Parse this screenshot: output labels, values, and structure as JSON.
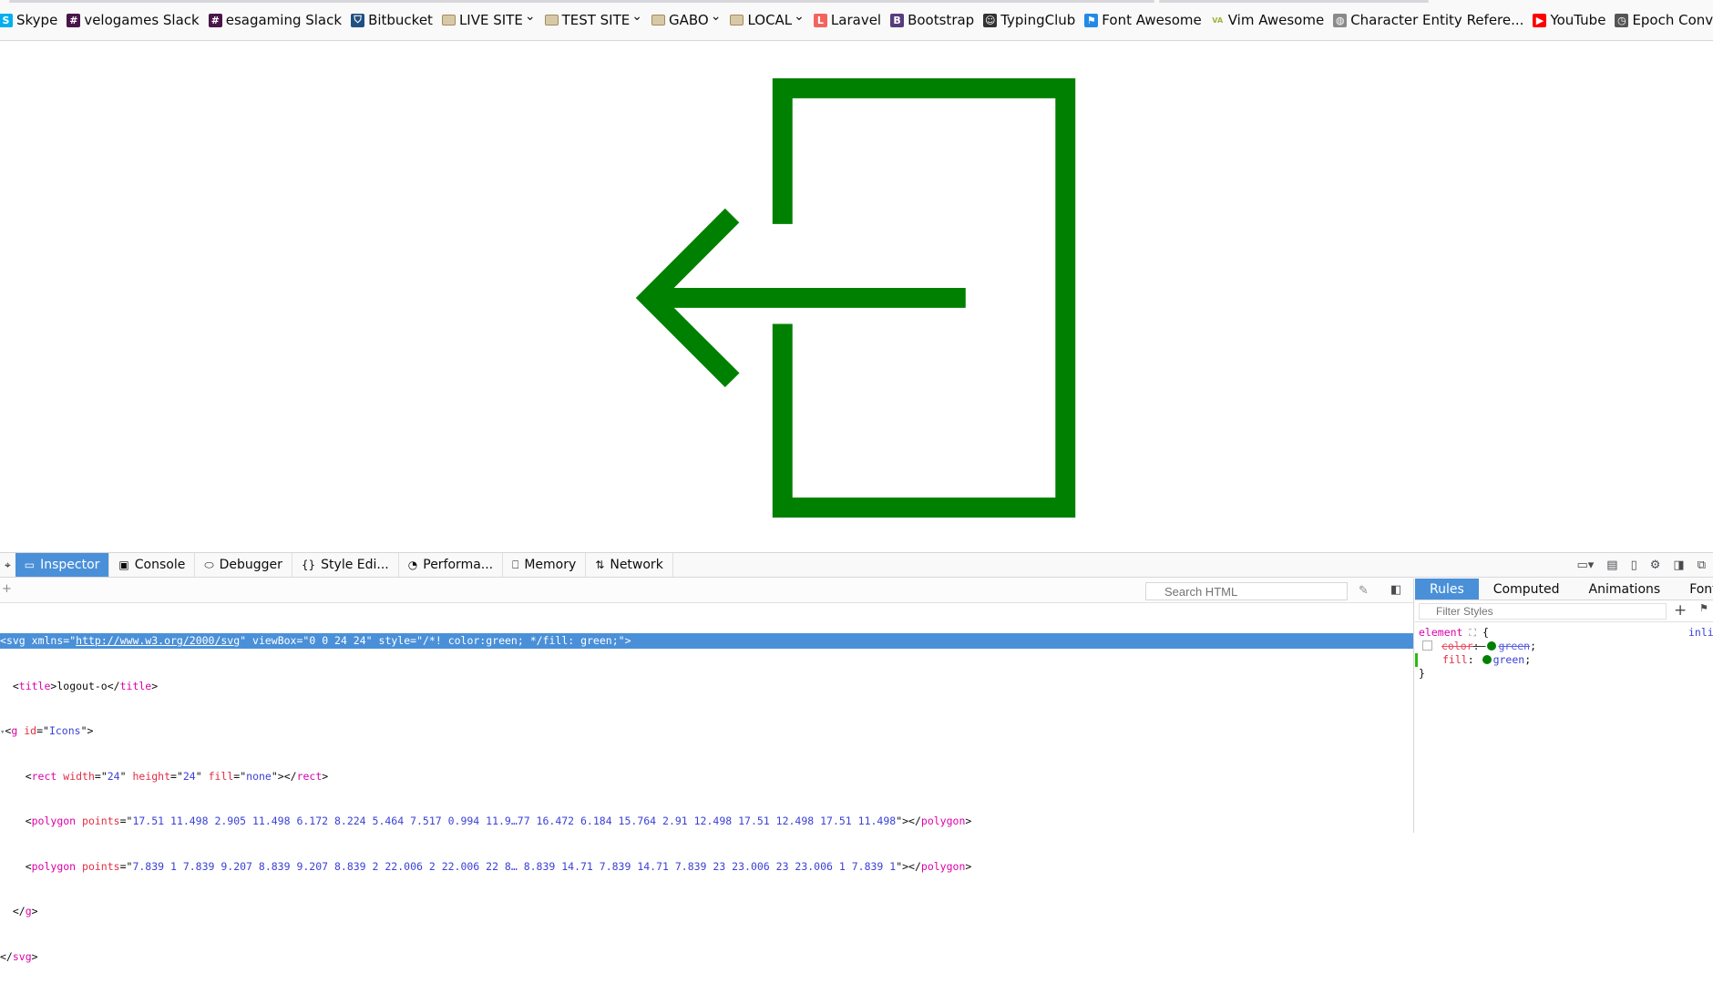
{
  "bookmarks": [
    {
      "label": "Skype",
      "icon": "skype-icon",
      "folder": false
    },
    {
      "label": "velogames Slack",
      "icon": "slack-icon",
      "folder": false
    },
    {
      "label": "esagaming Slack",
      "icon": "slack-icon",
      "folder": false
    },
    {
      "label": "Bitbucket",
      "icon": "bitbucket-icon",
      "folder": false
    },
    {
      "label": "LIVE SITE",
      "icon": "folder-icon",
      "folder": true
    },
    {
      "label": "TEST SITE",
      "icon": "folder-icon",
      "folder": true
    },
    {
      "label": "GABO",
      "icon": "folder-icon",
      "folder": true
    },
    {
      "label": "LOCAL",
      "icon": "folder-icon",
      "folder": true
    },
    {
      "label": "Laravel",
      "icon": "laravel-icon",
      "folder": false
    },
    {
      "label": "Bootstrap",
      "icon": "bootstrap-icon",
      "folder": false
    },
    {
      "label": "TypingClub",
      "icon": "typingclub-icon",
      "folder": false
    },
    {
      "label": "Font Awesome",
      "icon": "fontawesome-icon",
      "folder": false
    },
    {
      "label": "Vim Awesome",
      "icon": "vimawesome-icon",
      "folder": false
    },
    {
      "label": "Character Entity Refere...",
      "icon": "globe-icon",
      "folder": false
    },
    {
      "label": "YouTube",
      "icon": "youtube-icon",
      "folder": false
    },
    {
      "label": "Epoch Converter - Unix ...",
      "icon": "clock-icon",
      "folder": false
    }
  ],
  "page": {
    "icon_color": "#008000"
  },
  "devtools": {
    "tabs": [
      {
        "label": "Inspector",
        "icon": "inspector-icon",
        "active": true
      },
      {
        "label": "Console",
        "icon": "console-icon",
        "active": false
      },
      {
        "label": "Debugger",
        "icon": "debugger-icon",
        "active": false
      },
      {
        "label": "Style Edi...",
        "icon": "style-editor-icon",
        "active": false
      },
      {
        "label": "Performa...",
        "icon": "performance-icon",
        "active": false
      },
      {
        "label": "Memory",
        "icon": "memory-icon",
        "active": false
      },
      {
        "label": "Network",
        "icon": "network-icon",
        "active": false
      }
    ],
    "search_placeholder": "Search HTML",
    "markup": {
      "svg_open": {
        "tag": "svg",
        "xmlns_attr": "xmlns",
        "xmlns_val": "http://www.w3.org/2000/svg",
        "viewbox_attr": "viewBox",
        "viewbox_val": "0 0 24 24",
        "style_attr": "style",
        "style_val": "/*! color:green; */fill: green;"
      },
      "title_text": "logout-o",
      "g_id": "Icons",
      "rect_width": "24",
      "rect_height": "24",
      "rect_fill": "none",
      "polygon1_points": "17.51 11.498 2.905 11.498 6.172 8.224 5.464 7.517 0.994 11.9…77 16.472 6.184 15.764 2.91 12.498 17.51 12.498 17.51 11.498",
      "polygon2_points": "7.839 1 7.839 9.207 8.839 9.207 8.839 2 22.006 2 22.006 22 8… 8.839 14.71 7.839 14.71 7.839 23 23.006 23 23.006 1 7.839 1"
    },
    "rules": {
      "tabs": [
        {
          "label": "Rules",
          "active": true
        },
        {
          "label": "Computed",
          "active": false
        },
        {
          "label": "Animations",
          "active": false
        },
        {
          "label": "Fonts",
          "active": false
        }
      ],
      "filter_placeholder": "Filter Styles",
      "selector": "element",
      "inline_label": "inline",
      "declarations": [
        {
          "name": "color",
          "value": "green",
          "disabled": true
        },
        {
          "name": "fill",
          "value": "green",
          "disabled": false
        }
      ]
    }
  }
}
